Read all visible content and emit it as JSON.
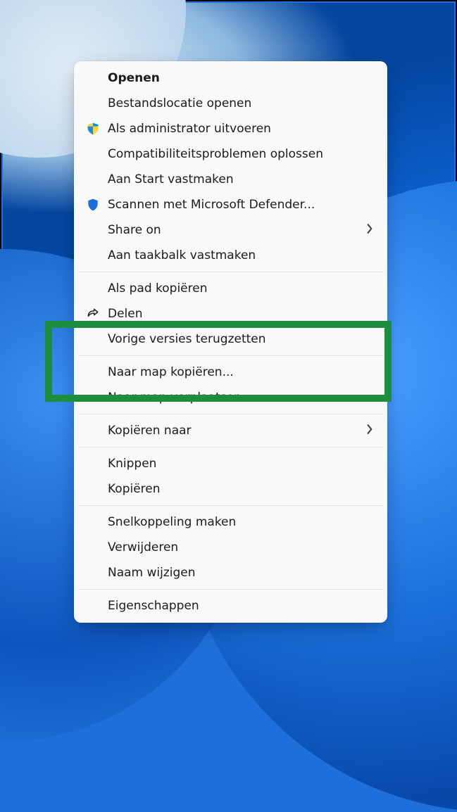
{
  "contextMenu": {
    "groups": [
      [
        {
          "key": "open",
          "label": "Openen",
          "bold": true,
          "icon": null,
          "submenu": false
        },
        {
          "key": "openloc",
          "label": "Bestandslocatie openen",
          "bold": false,
          "icon": null,
          "submenu": false
        },
        {
          "key": "runadmin",
          "label": "Als administrator uitvoeren",
          "bold": false,
          "icon": "shield-uac",
          "submenu": false
        },
        {
          "key": "compat",
          "label": "Compatibiliteitsproblemen oplossen",
          "bold": false,
          "icon": null,
          "submenu": false
        },
        {
          "key": "pinstart",
          "label": "Aan Start vastmaken",
          "bold": false,
          "icon": null,
          "submenu": false
        },
        {
          "key": "defender",
          "label": "Scannen met Microsoft Defender...",
          "bold": false,
          "icon": "shield-defender",
          "submenu": false
        },
        {
          "key": "shareon",
          "label": "Share on",
          "bold": false,
          "icon": null,
          "submenu": true
        },
        {
          "key": "pintaskbar",
          "label": "Aan taakbalk vastmaken",
          "bold": false,
          "icon": null,
          "submenu": false
        }
      ],
      [
        {
          "key": "copypath",
          "label": "Als pad kopiëren",
          "bold": false,
          "icon": null,
          "submenu": false
        },
        {
          "key": "share",
          "label": "Delen",
          "bold": false,
          "icon": "share",
          "submenu": false
        },
        {
          "key": "prevver",
          "label": "Vorige versies terugzetten",
          "bold": false,
          "icon": null,
          "submenu": false
        }
      ],
      [
        {
          "key": "copytofolder",
          "label": "Naar map kopiëren...",
          "bold": false,
          "icon": null,
          "submenu": false
        },
        {
          "key": "movetofolder",
          "label": "Naar map verplaatsen...",
          "bold": false,
          "icon": null,
          "submenu": false
        }
      ],
      [
        {
          "key": "copyto",
          "label": "Kopiëren naar",
          "bold": false,
          "icon": null,
          "submenu": true
        }
      ],
      [
        {
          "key": "cut",
          "label": "Knippen",
          "bold": false,
          "icon": null,
          "submenu": false
        },
        {
          "key": "copy",
          "label": "Kopiëren",
          "bold": false,
          "icon": null,
          "submenu": false
        }
      ],
      [
        {
          "key": "shortcut",
          "label": "Snelkoppeling maken",
          "bold": false,
          "icon": null,
          "submenu": false
        },
        {
          "key": "delete",
          "label": "Verwijderen",
          "bold": false,
          "icon": null,
          "submenu": false
        },
        {
          "key": "rename",
          "label": "Naam wijzigen",
          "bold": false,
          "icon": null,
          "submenu": false
        }
      ],
      [
        {
          "key": "properties",
          "label": "Eigenschappen",
          "bold": false,
          "icon": null,
          "submenu": false
        }
      ]
    ]
  },
  "highlight": {
    "color": "#1e8e3e",
    "targets": [
      "copytofolder",
      "movetofolder"
    ]
  }
}
